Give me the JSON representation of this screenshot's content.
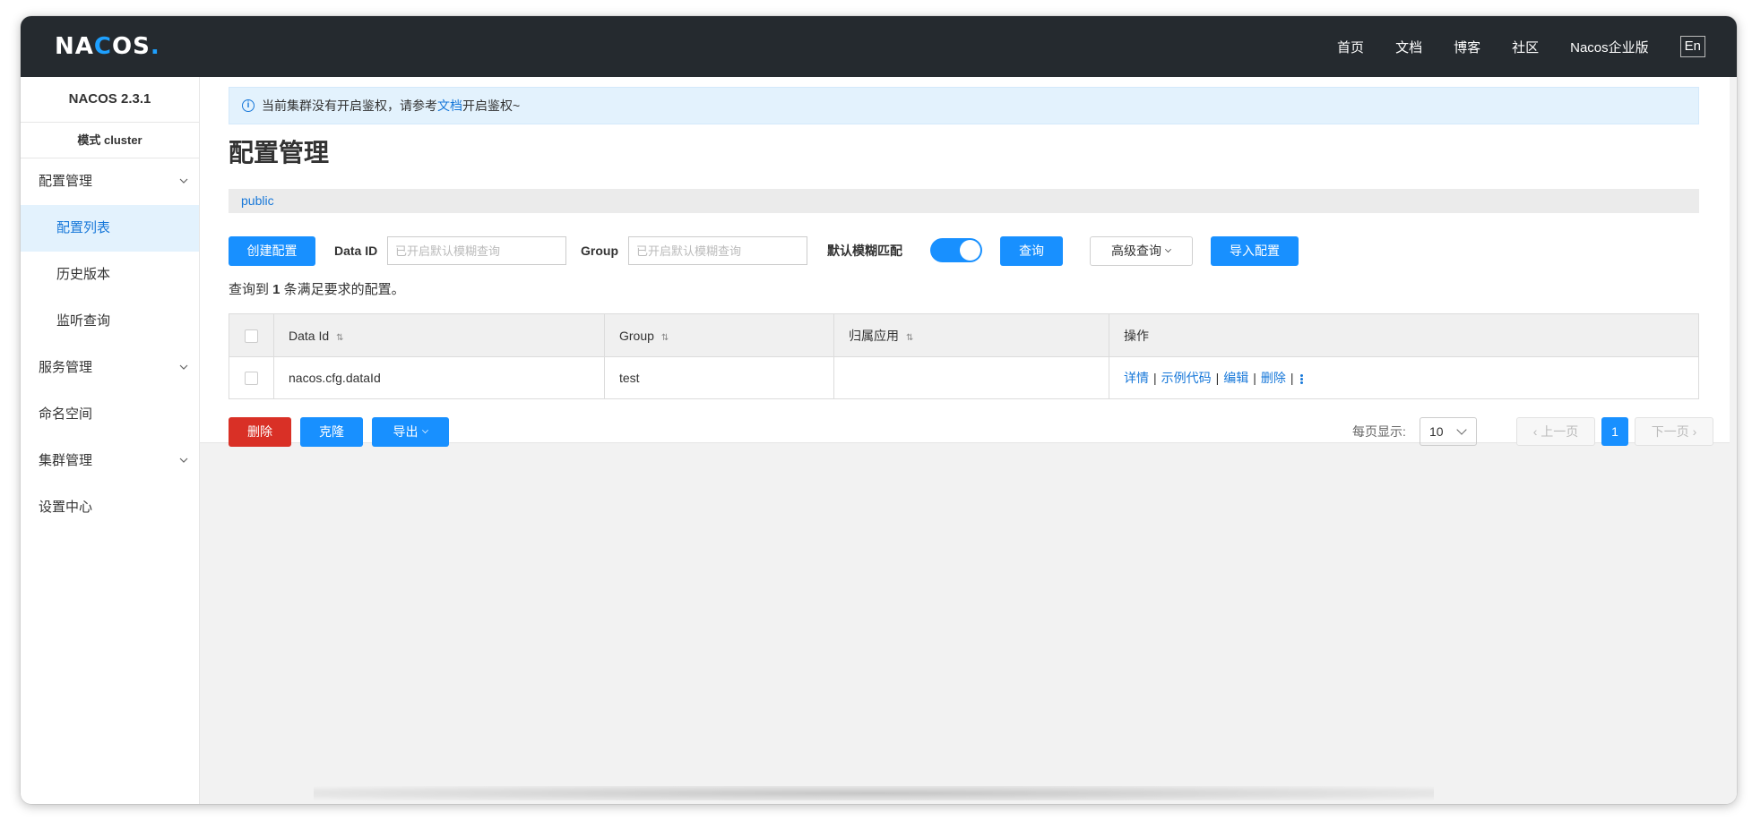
{
  "header": {
    "logo": {
      "a": "NA",
      "c": "C",
      "b": "OS",
      "dot": "."
    },
    "nav": [
      "首页",
      "文档",
      "博客",
      "社区",
      "Nacos企业版"
    ],
    "lang": "En"
  },
  "sidebar": {
    "version": "NACOS 2.3.1",
    "mode": "模式 cluster",
    "items": [
      {
        "label": "配置管理"
      },
      {
        "label": "配置列表"
      },
      {
        "label": "历史版本"
      },
      {
        "label": "监听查询"
      },
      {
        "label": "服务管理"
      },
      {
        "label": "命名空间"
      },
      {
        "label": "集群管理"
      },
      {
        "label": "设置中心"
      }
    ]
  },
  "notice": {
    "before": "当前集群没有开启鉴权，请参考",
    "link": "文档",
    "after": "开启鉴权~",
    "icon": "info-icon"
  },
  "page": {
    "title": "配置管理",
    "namespace": "public"
  },
  "toolbar": {
    "create": "创建配置",
    "dataid_label": "Data ID",
    "dataid_placeholder": "已开启默认模糊查询",
    "group_label": "Group",
    "group_placeholder": "已开启默认模糊查询",
    "fuzzy_label": "默认模糊匹配",
    "fuzzy_on": true,
    "query": "查询",
    "advanced": "高级查询",
    "import": "导入配置"
  },
  "result": {
    "prefix": "查询到 ",
    "count": "1",
    "suffix": " 条满足要求的配置。"
  },
  "table": {
    "headers": [
      "Data Id",
      "Group",
      "归属应用",
      "操作"
    ],
    "rows": [
      {
        "data_id": "nacos.cfg.dataId",
        "group": "test",
        "app": "",
        "ops": [
          "详情",
          "示例代码",
          "编辑",
          "删除"
        ]
      }
    ]
  },
  "bottom": {
    "delete": "删除",
    "clone": "克隆",
    "export": "导出",
    "per_page_label": "每页显示:",
    "per_page": "10",
    "prev": "上一页",
    "page": "1",
    "next": "下一页"
  }
}
